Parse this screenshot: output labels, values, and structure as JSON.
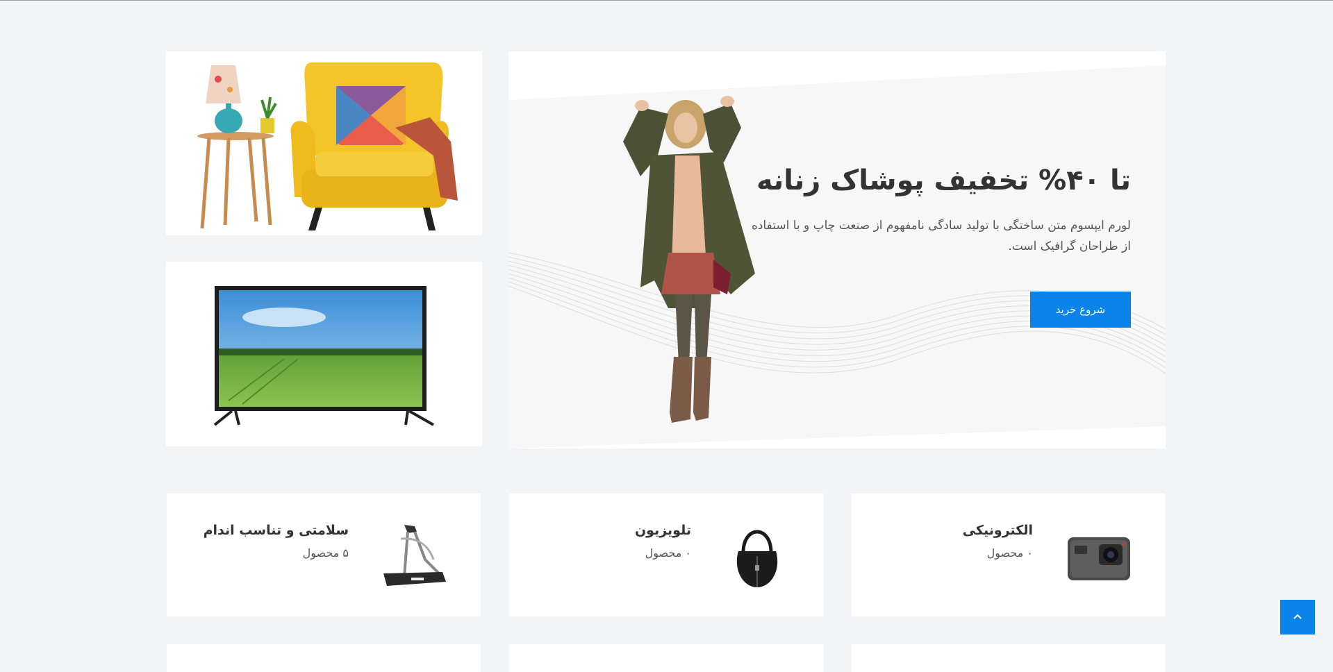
{
  "hero": {
    "title": "تا ۴۰% تخفیف پوشاک زنانه",
    "description": "لورم ایپسوم متن ساختگی با تولید سادگی نامفهوم از صنعت چاپ و با استفاده از طراحان گرافیک است.",
    "button_label": "شروع خرید"
  },
  "promos": [
    {
      "image": "armchair-with-side-table"
    },
    {
      "image": "flat-screen-television"
    }
  ],
  "categories": [
    {
      "title": "الکترونیکی",
      "count": "۰ محصول",
      "icon": "action-camera-icon"
    },
    {
      "title": "تلویزیون",
      "count": "۰ محصول",
      "icon": "handbag-icon"
    },
    {
      "title": "سلامتی و تناسب اندام",
      "count": "۵ محصول",
      "icon": "treadmill-icon"
    }
  ],
  "scroll_top": {
    "icon": "chevron-up-icon"
  },
  "colors": {
    "accent": "#0a84e8",
    "background": "#f3f4f6",
    "card": "#ffffff"
  }
}
